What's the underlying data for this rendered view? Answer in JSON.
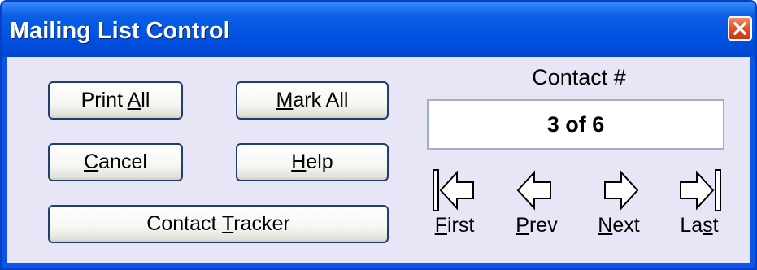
{
  "window": {
    "title": "Mailing List Control"
  },
  "buttons": {
    "print_all": {
      "text": "Print All",
      "mnemonic": "A"
    },
    "mark_all": {
      "text": "Mark All",
      "mnemonic": "M"
    },
    "cancel": {
      "text": "Cancel",
      "mnemonic": "C"
    },
    "help": {
      "text": "Help",
      "mnemonic": "H"
    },
    "contact_tracker": {
      "text": "Contact Tracker",
      "mnemonic": "T"
    }
  },
  "contact": {
    "label": "Contact #",
    "value": "3 of 6"
  },
  "navigation": {
    "first": {
      "text": "First",
      "mnemonic": "F",
      "icon": "first-record-icon"
    },
    "prev": {
      "text": "Prev",
      "mnemonic": "P",
      "icon": "previous-record-icon"
    },
    "next": {
      "text": "Next",
      "mnemonic": "N",
      "icon": "next-record-icon"
    },
    "last": {
      "text": "Last",
      "mnemonic": "s",
      "icon": "last-record-icon"
    }
  },
  "colors": {
    "titlebar": "#0050e0",
    "client": "#e8e6f6",
    "close": "#e0502a"
  }
}
